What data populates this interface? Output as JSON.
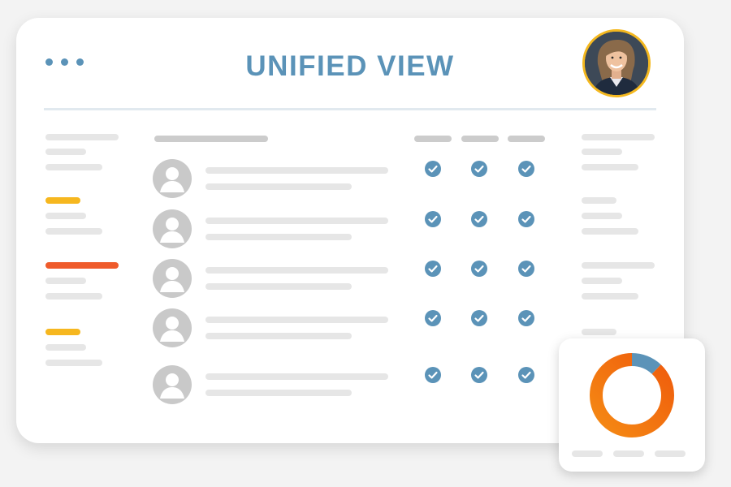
{
  "header": {
    "title": "UNIFIED VIEW",
    "menu_icon": "ellipsis-icon",
    "avatar_icon": "user-photo"
  },
  "rows": [
    {
      "checks": [
        true,
        true,
        true
      ]
    },
    {
      "checks": [
        true,
        true,
        true
      ]
    },
    {
      "checks": [
        true,
        true,
        true
      ]
    },
    {
      "checks": [
        true,
        true,
        true
      ]
    },
    {
      "checks": [
        true,
        true,
        true
      ]
    }
  ],
  "sidebar_markers": [
    {
      "color": "#f6b71f"
    },
    {
      "color": "#ef5b2b"
    },
    {
      "color": "#f6b71f"
    }
  ],
  "chart_data": {
    "type": "pie",
    "variant": "donut",
    "values": [
      0.12,
      0.88
    ],
    "colors": [
      "#5b93b8",
      "#f26a10"
    ]
  },
  "colors": {
    "accent": "#5b93b8",
    "avatar_ring": "#f4b81f",
    "placeholder": "#e6e6e6",
    "check": "#5b93b8"
  }
}
